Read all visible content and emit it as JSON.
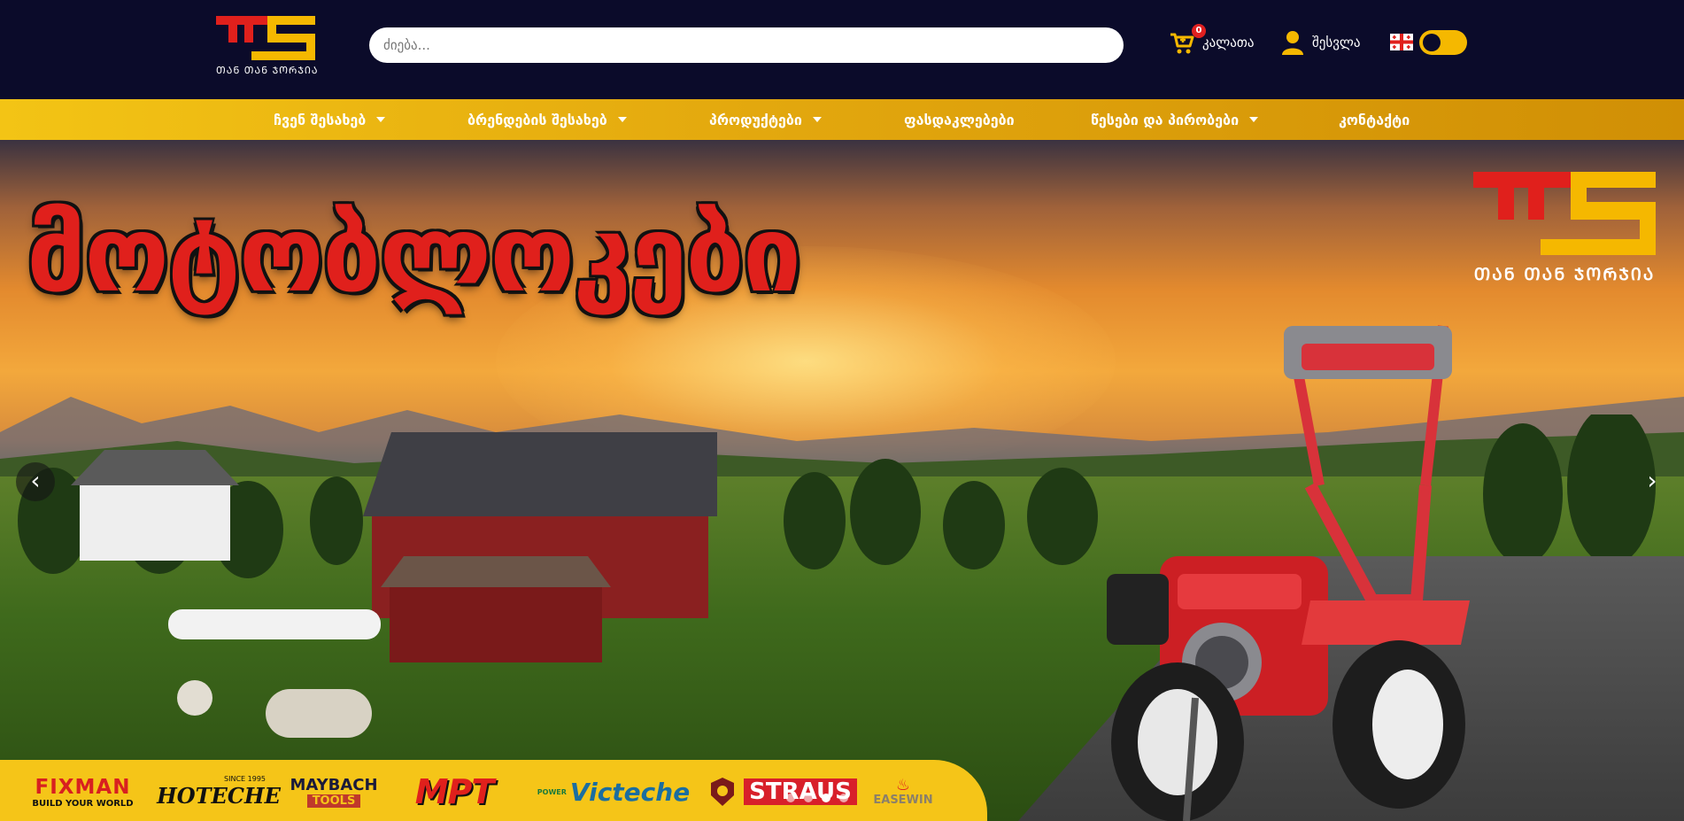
{
  "header": {
    "logo_tagline": "ᲗᲐᲜ ᲗᲐᲜ ᲯᲝᲠᲯᲘᲐ",
    "search_placeholder": "ძიება...",
    "cart_label": "კალათა",
    "cart_count": "0",
    "login_label": "შესვლა"
  },
  "nav": {
    "items": [
      {
        "label": "ჩვენ შესახებ",
        "dropdown": true
      },
      {
        "label": "ბრენდების შესახებ",
        "dropdown": true
      },
      {
        "label": "პროდუქტები",
        "dropdown": true
      },
      {
        "label": "ფასდაკლებები",
        "dropdown": false
      },
      {
        "label": "წესები და პირობები",
        "dropdown": true
      },
      {
        "label": "კონტაქტი",
        "dropdown": false
      }
    ]
  },
  "hero": {
    "title": "მოტობლოკები",
    "logo_tagline": "ᲗᲐᲜ ᲗᲐᲜ ᲯᲝᲠᲯᲘᲐ",
    "prev_label": "‹",
    "next_label": "›",
    "slides_total": 4,
    "active_slide": 1
  },
  "brands": [
    {
      "name": "FIXMAN",
      "sub": "BUILD YOUR WORLD"
    },
    {
      "name": "HOTECHE",
      "sub": "SINCE 1995"
    },
    {
      "name": "MAYBACH",
      "sub": "TOOLS"
    },
    {
      "name": "MPT",
      "sub": ""
    },
    {
      "name": "Victeche",
      "sub": "POWER"
    },
    {
      "name": "",
      "sub": ""
    },
    {
      "name": "STRAUS",
      "sub": ""
    },
    {
      "name": "EASEWIN",
      "sub": ""
    }
  ],
  "colors": {
    "header_bg": "#0b0b2a",
    "accent_yellow": "#f5c518",
    "brand_red": "#e0201c"
  }
}
